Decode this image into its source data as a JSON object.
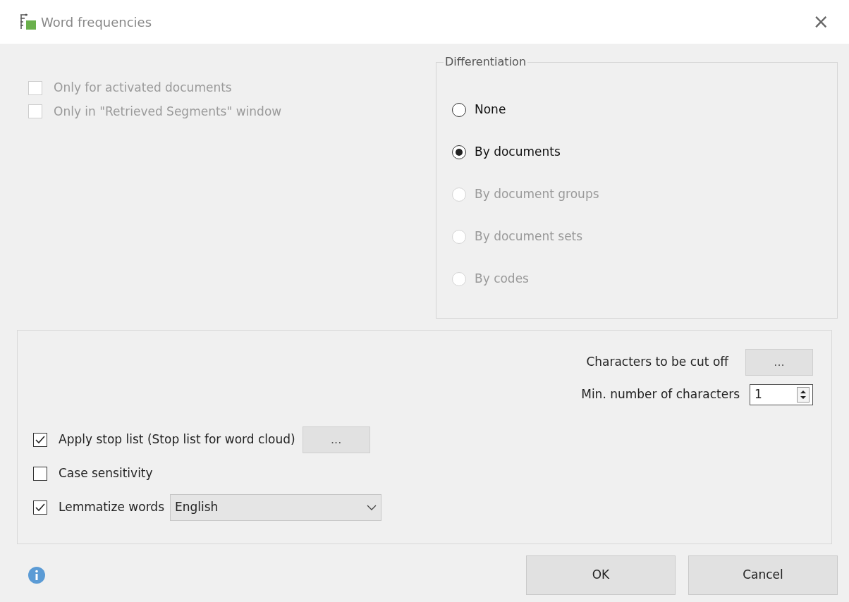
{
  "window": {
    "title": "Word frequencies",
    "close": "×"
  },
  "filters": [
    {
      "label": "Only for activated documents",
      "checked": false,
      "disabled": true
    },
    {
      "label": "Only in \"Retrieved Segments\" window",
      "checked": false,
      "disabled": true
    }
  ],
  "differentiation": {
    "title": "Differentiation",
    "options": [
      {
        "label": "None",
        "selected": false,
        "disabled": false
      },
      {
        "label": "By documents",
        "selected": true,
        "disabled": false
      },
      {
        "label": "By document groups",
        "selected": false,
        "disabled": true
      },
      {
        "label": "By document sets",
        "selected": false,
        "disabled": true
      },
      {
        "label": "By codes",
        "selected": false,
        "disabled": true
      }
    ]
  },
  "cut_off": {
    "label": "Characters to be cut off",
    "button": "..."
  },
  "min_chars": {
    "label": "Min. number of characters",
    "value": "1"
  },
  "options": [
    {
      "kind": "button",
      "label": "Apply stop list (Stop list for word cloud)",
      "checked": true,
      "button": "..."
    },
    {
      "kind": "plain",
      "label": "Case sensitivity",
      "checked": false
    },
    {
      "kind": "dropdown",
      "label": "Lemmatize words",
      "checked": true,
      "value": "English"
    }
  ],
  "buttons": [
    {
      "label": "OK"
    },
    {
      "label": "Cancel"
    }
  ]
}
